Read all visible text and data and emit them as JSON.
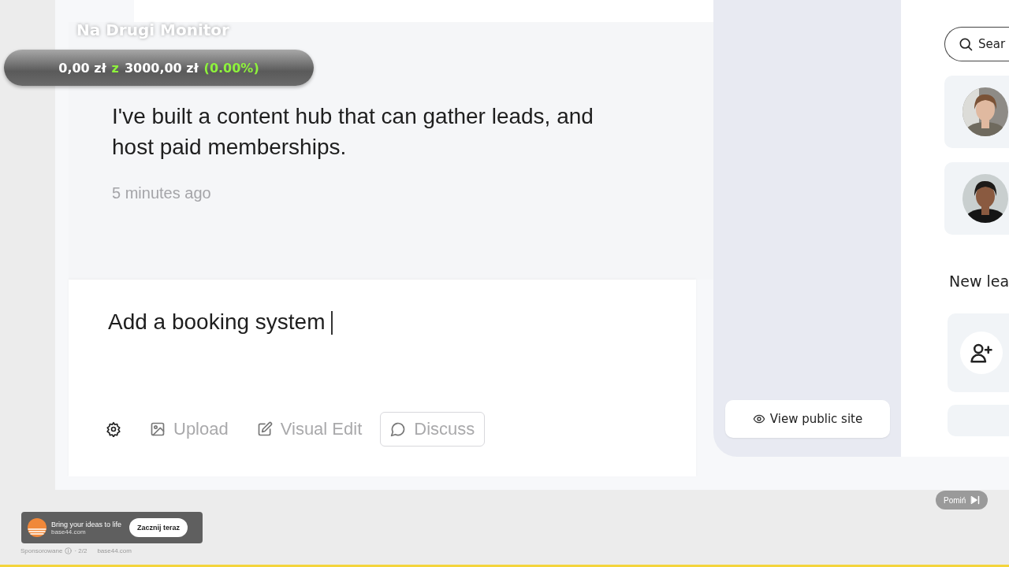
{
  "overlay": {
    "title": "Na Drugi Monitor",
    "goal": {
      "raised": "0,00 zł",
      "separator": "z",
      "target": "3000,00 zł",
      "percent": "(0.00%)"
    }
  },
  "chat": {
    "message": "I've built a content hub that can gather leads, and host paid memberships.",
    "time": "5 minutes ago",
    "input": {
      "value": "Add a booking system "
    },
    "tools": [
      {
        "kind": "settings"
      },
      {
        "kind": "upload",
        "label": "Upload",
        "selected": false
      },
      {
        "kind": "visual-edit",
        "label": "Visual Edit",
        "selected": false
      },
      {
        "kind": "discuss",
        "label": "Discuss",
        "selected": true
      }
    ]
  },
  "preview": {
    "view_button": "View public site",
    "search": {
      "placeholder": "Sear"
    },
    "section_title": "New lea",
    "cards": [
      {
        "kind": "add-user"
      },
      {
        "kind": "empty"
      }
    ]
  },
  "ad": {
    "headline": "Bring your ideas to life",
    "domain": "base44.com",
    "cta": "Zacznij teraz",
    "sponsored": "Sponsorowane",
    "count": "· 2/2",
    "site": "base44.com",
    "skip": "Pomiń"
  }
}
